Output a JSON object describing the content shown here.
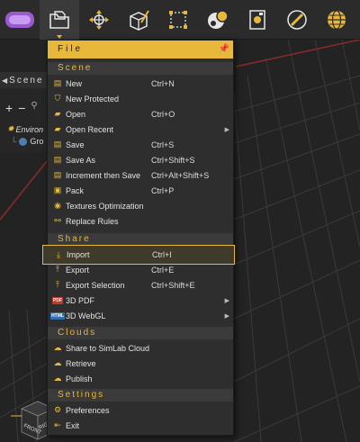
{
  "toolbar": {
    "buttons": [
      {
        "icon": "vr-headset-icon",
        "active": false
      },
      {
        "icon": "file-menu-icon",
        "active": true
      },
      {
        "icon": "transform-move-icon",
        "active": false
      },
      {
        "icon": "box-edit-icon",
        "active": false
      },
      {
        "icon": "selection-box-icon",
        "active": false
      },
      {
        "icon": "materials-icon",
        "active": false
      },
      {
        "icon": "render-icon",
        "active": false
      },
      {
        "icon": "pencil-icon",
        "active": false
      },
      {
        "icon": "globe-icon",
        "active": false
      }
    ]
  },
  "scene": {
    "header": "Scene",
    "tree": {
      "environment": "Environ",
      "group": "Gro"
    }
  },
  "menu": {
    "title": "File",
    "sections": {
      "scene": "Scene",
      "share": "Share",
      "clouds": "Clouds",
      "settings": "Settings"
    },
    "items": {
      "new": {
        "label": "New",
        "shortcut": "Ctrl+N"
      },
      "new_protected": {
        "label": "New Protected",
        "shortcut": ""
      },
      "open": {
        "label": "Open",
        "shortcut": "Ctrl+O"
      },
      "open_recent": {
        "label": "Open Recent",
        "shortcut": ""
      },
      "save": {
        "label": "Save",
        "shortcut": "Ctrl+S"
      },
      "save_as": {
        "label": "Save As",
        "shortcut": "Ctrl+Shift+S"
      },
      "increment_save": {
        "label": "Increment then Save",
        "shortcut": "Ctrl+Alt+Shift+S"
      },
      "pack": {
        "label": "Pack",
        "shortcut": "Ctrl+P"
      },
      "textures_optimization": {
        "label": "Textures Optimization",
        "shortcut": ""
      },
      "replace_rules": {
        "label": "Replace Rules",
        "shortcut": ""
      },
      "import": {
        "label": "Import",
        "shortcut": "Ctrl+I"
      },
      "export": {
        "label": "Export",
        "shortcut": "Ctrl+E"
      },
      "export_selection": {
        "label": "Export Selection",
        "shortcut": "Ctrl+Shift+E"
      },
      "pdf3d": {
        "label": "3D PDF",
        "shortcut": "",
        "tag": "PDF"
      },
      "webgl3d": {
        "label": "3D WebGL",
        "shortcut": "",
        "tag": "HTML"
      },
      "share_cloud": {
        "label": "Share to SimLab Cloud",
        "shortcut": ""
      },
      "retrieve": {
        "label": "Retrieve",
        "shortcut": ""
      },
      "publish": {
        "label": "Publish",
        "shortcut": ""
      },
      "preferences": {
        "label": "Preferences",
        "shortcut": ""
      },
      "exit": {
        "label": "Exit",
        "shortcut": ""
      }
    }
  },
  "viewcube": {
    "front": "FRONT",
    "right": "RIGHT"
  },
  "colors": {
    "accent": "#e8b83a",
    "menu_bg": "#2e2e2e",
    "section_bg": "#3b3b3b",
    "viewport_bg": "#232323"
  }
}
